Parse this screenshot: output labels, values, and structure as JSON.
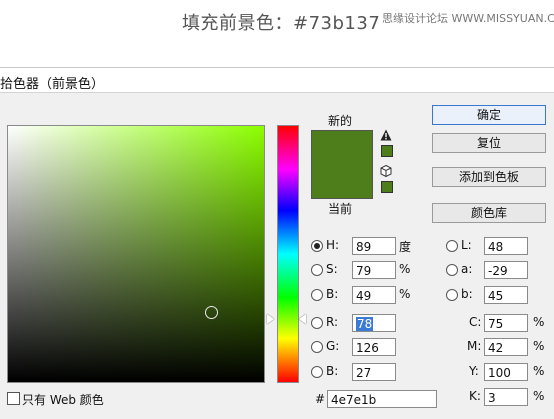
{
  "caption": "填充前景色：#73b137",
  "watermark": "思缘设计论坛 WWW.MISSYUAN.COM",
  "dialog": {
    "title": "拾色器（前景色）",
    "new_label": "新的",
    "current_label": "当前",
    "new_color": "#4e7e1b",
    "current_color": "#4e7e1b",
    "buttons": {
      "ok": "确定",
      "reset": "复位",
      "add_to_swatches": "添加到色板",
      "color_libraries": "颜色库"
    },
    "hsb": {
      "h_label": "H:",
      "h_value": "89",
      "h_unit": "度",
      "s_label": "S:",
      "s_value": "79",
      "s_unit": "%",
      "b_label": "B:",
      "b_value": "49",
      "b_unit": "%"
    },
    "rgb": {
      "r_label": "R:",
      "r_value": "78",
      "g_label": "G:",
      "g_value": "126",
      "b_label": "B:",
      "b_value": "27"
    },
    "lab": {
      "l_label": "L:",
      "l_value": "48",
      "a_label": "a:",
      "a_value": "-29",
      "b_label": "b:",
      "b_value": "45"
    },
    "cmyk": {
      "c_label": "C:",
      "c_value": "75",
      "c_unit": "%",
      "m_label": "M:",
      "m_value": "42",
      "m_unit": "%",
      "y_label": "Y:",
      "y_value": "100",
      "y_unit": "%",
      "k_label": "K:",
      "k_value": "3",
      "k_unit": "%"
    },
    "hex_label": "#",
    "hex_value": "4e7e1b",
    "web_only_label": "只有 Web 颜色"
  }
}
